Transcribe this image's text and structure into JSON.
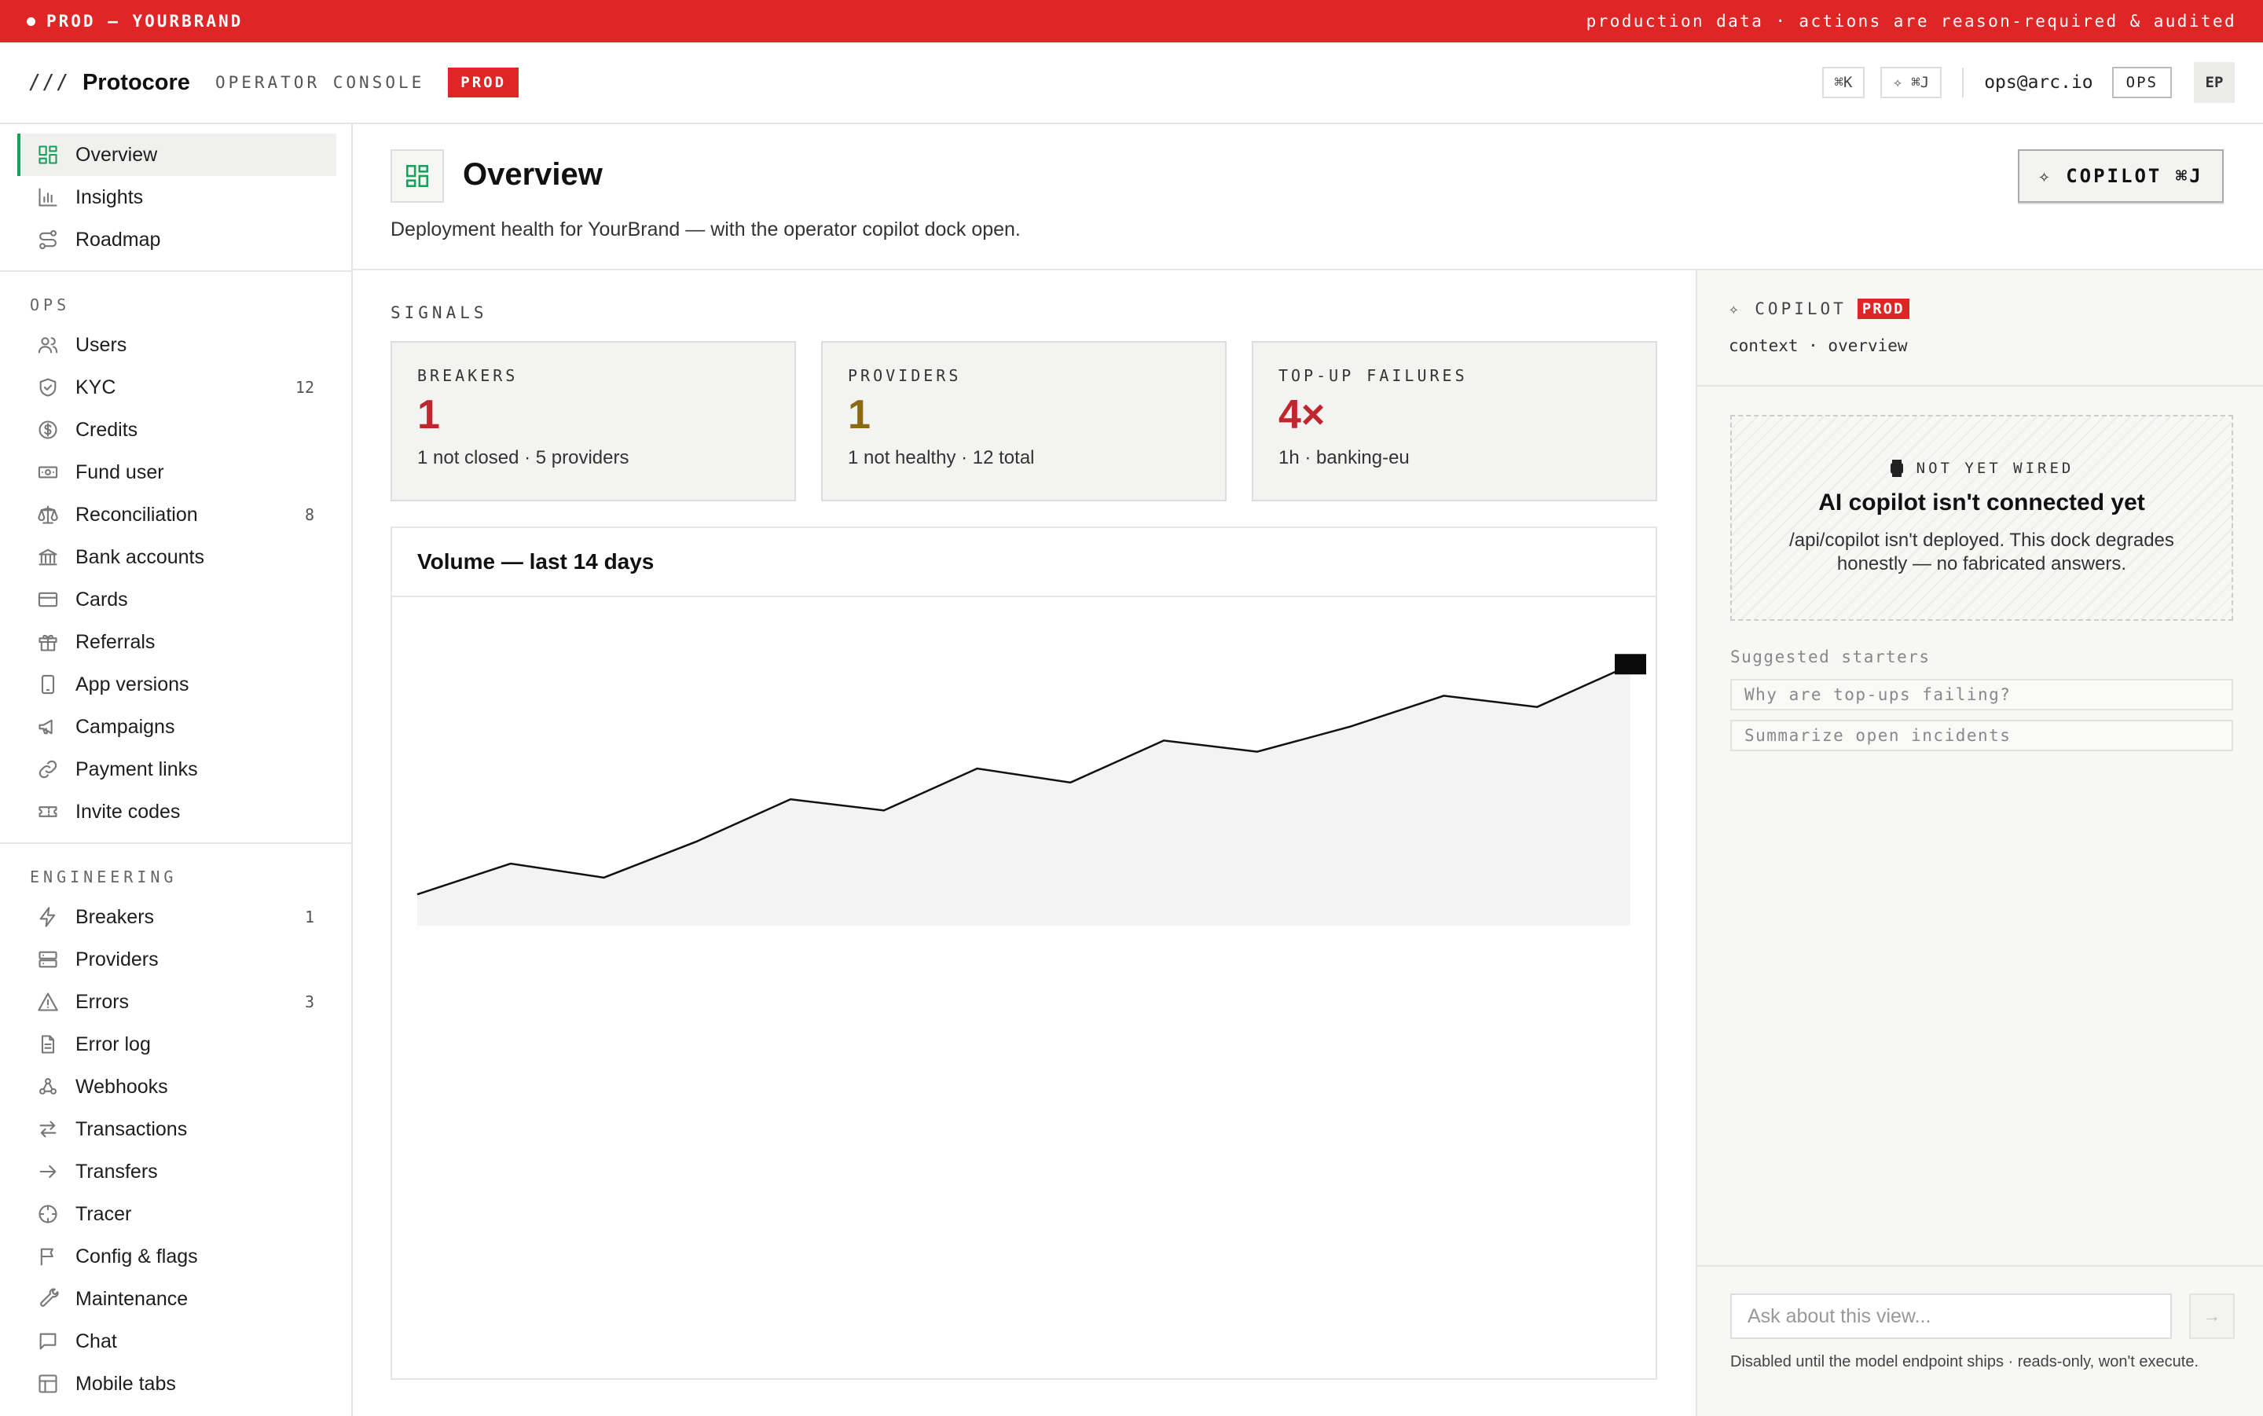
{
  "banner": {
    "left": "PROD — YOURBRAND",
    "right": "production data · actions are reason-required & audited",
    "color": "#de2626"
  },
  "topbar": {
    "slashes": "///",
    "brand": "Protocore",
    "subtitle": "OPERATOR CONSOLE",
    "env": "PROD",
    "kbd_search": "⌘K",
    "kbd_copilot": "✧ ⌘J",
    "email": "ops@arc.io",
    "role": "OPS",
    "avatar": "EP"
  },
  "sidebar": {
    "top_items": [
      {
        "label": "Overview",
        "icon": "grid-icon"
      },
      {
        "label": "Insights",
        "icon": "bar-chart-icon"
      },
      {
        "label": "Roadmap",
        "icon": "route-icon"
      }
    ],
    "ops_label": "OPS",
    "ops_items": [
      {
        "label": "Users",
        "badge": ""
      },
      {
        "label": "KYC",
        "badge": "12"
      },
      {
        "label": "Credits",
        "badge": ""
      },
      {
        "label": "Fund user",
        "badge": ""
      },
      {
        "label": "Reconciliation",
        "badge": "8"
      },
      {
        "label": "Bank accounts",
        "badge": ""
      },
      {
        "label": "Cards",
        "badge": ""
      },
      {
        "label": "Referrals",
        "badge": ""
      },
      {
        "label": "App versions",
        "badge": ""
      },
      {
        "label": "Campaigns",
        "badge": ""
      },
      {
        "label": "Payment links",
        "badge": ""
      },
      {
        "label": "Invite codes",
        "badge": ""
      }
    ],
    "eng_label": "ENGINEERING",
    "eng_items": [
      {
        "label": "Breakers",
        "badge": "1"
      },
      {
        "label": "Providers",
        "badge": ""
      },
      {
        "label": "Errors",
        "badge": "3"
      },
      {
        "label": "Error log",
        "badge": ""
      },
      {
        "label": "Webhooks",
        "badge": ""
      },
      {
        "label": "Transactions",
        "badge": ""
      },
      {
        "label": "Transfers",
        "badge": ""
      },
      {
        "label": "Tracer",
        "badge": ""
      },
      {
        "label": "Config & flags",
        "badge": ""
      },
      {
        "label": "Maintenance",
        "badge": ""
      },
      {
        "label": "Chat",
        "badge": ""
      },
      {
        "label": "Mobile tabs",
        "badge": ""
      }
    ]
  },
  "header": {
    "title": "Overview",
    "subtitle": "Deployment health for YourBrand — with the operator copilot dock open.",
    "copilot_button": "✧ COPILOT ⌘J"
  },
  "signals": {
    "label": "SIGNALS",
    "cards": [
      {
        "label": "BREAKERS",
        "value": "1",
        "foot": "1 not closed · 5 providers",
        "color": "#c0262d"
      },
      {
        "label": "PROVIDERS",
        "value": "1",
        "foot": "1 not healthy · 12 total",
        "color": "#8a6a12"
      },
      {
        "label": "TOP-UP FAILURES",
        "value": "4×",
        "foot": "1h · banking-eu",
        "color": "#c0262d"
      }
    ]
  },
  "chart": {
    "title": "Volume — last 14 days"
  },
  "chart_data": {
    "type": "area",
    "title": "Volume — last 14 days",
    "x": [
      1,
      2,
      3,
      4,
      5,
      6,
      7,
      8,
      9,
      10,
      11,
      12,
      13,
      14
    ],
    "values": [
      5,
      16,
      11,
      24,
      39,
      35,
      50,
      45,
      60,
      56,
      65,
      76,
      72,
      87
    ],
    "ylim": [
      0,
      100
    ],
    "grid": false,
    "legend": "none"
  },
  "copilot": {
    "title": "✧ COPILOT",
    "env": "PROD",
    "context": "context · overview",
    "status_label": "NOT YET WIRED",
    "status_title": "AI copilot isn't connected yet",
    "status_body": "/api/copilot isn't deployed. This dock degrades honestly — no fabricated answers.",
    "starters_label": "Suggested starters",
    "starters": [
      "Why are top-ups failing?",
      "Summarize open incidents"
    ],
    "input_placeholder": "Ask about this view...",
    "send": "→",
    "footnote": "Disabled until the model endpoint ships · reads-only, won't execute."
  }
}
